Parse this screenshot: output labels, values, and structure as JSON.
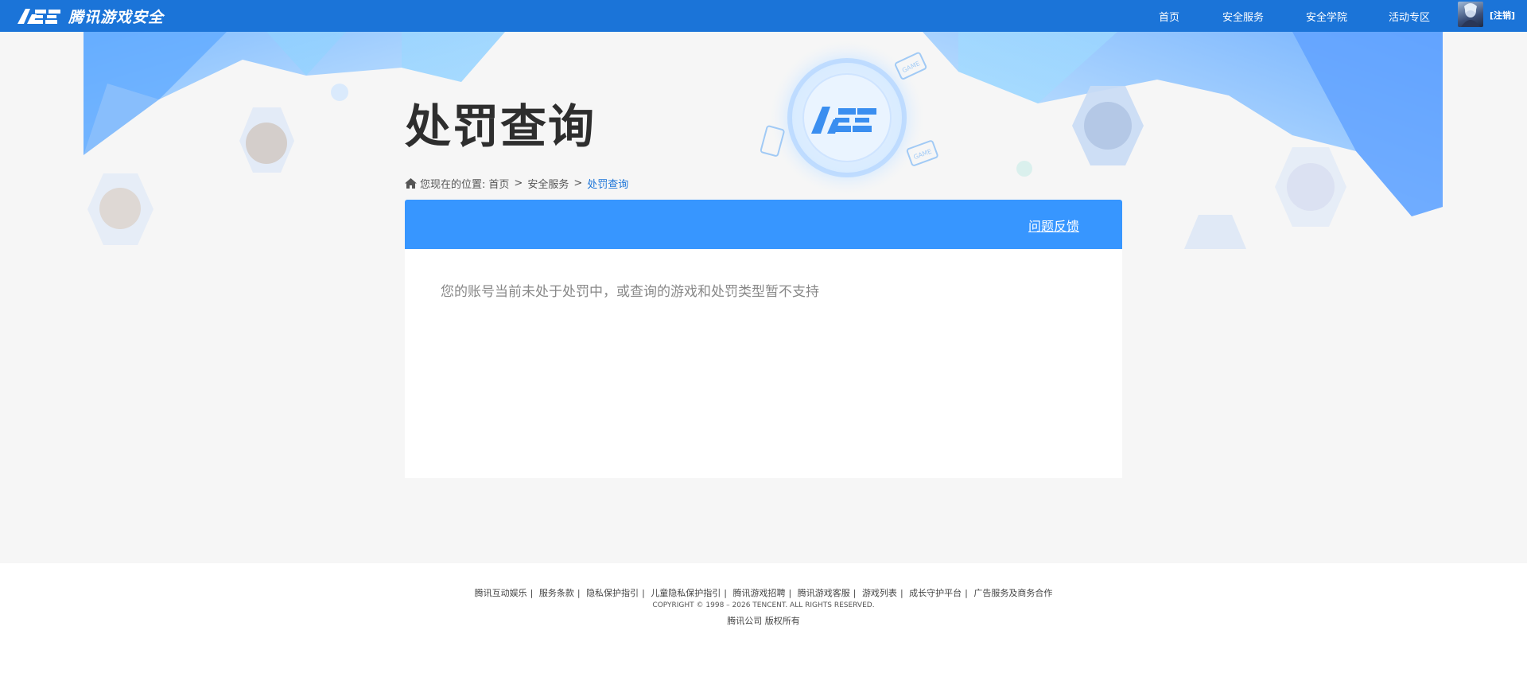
{
  "header": {
    "brand_text": "腾讯游戏安全",
    "nav": [
      {
        "label": "首页"
      },
      {
        "label": "安全服务"
      },
      {
        "label": "安全学院"
      },
      {
        "label": "活动专区"
      }
    ],
    "logout_label": "[注销]"
  },
  "page": {
    "title": "处罚查询"
  },
  "breadcrumb": {
    "prefix": "您现在的位置:",
    "items": [
      "首页",
      "安全服务"
    ],
    "current": "处罚查询"
  },
  "panel": {
    "feedback_label": "问题反馈",
    "message": "您的账号当前未处于处罚中，或查询的游戏和处罚类型暂不支持"
  },
  "footer": {
    "links": [
      "腾讯互动娱乐",
      "服务条款",
      "隐私保护指引",
      "儿童隐私保护指引",
      "腾讯游戏招聘",
      "腾讯游戏客服",
      "游戏列表",
      "成长守护平台",
      "广告服务及商务合作"
    ],
    "copyright": "COPYRIGHT © 1998 – 2026 TENCENT. ALL RIGHTS RESERVED.",
    "company": "腾讯公司 版权所有"
  },
  "colors": {
    "topbar": "#1b74d8",
    "panel_header": "#3796ff",
    "link_current": "#1b74d8"
  }
}
